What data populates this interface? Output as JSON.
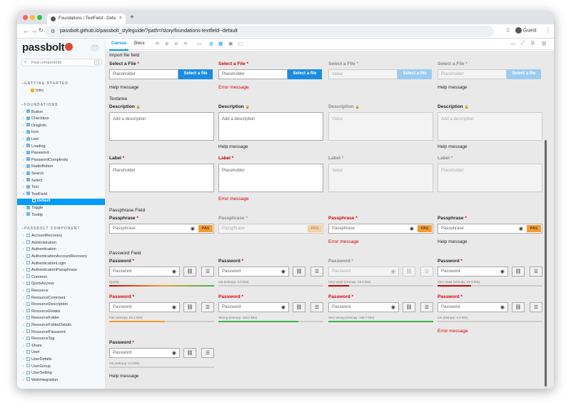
{
  "browser": {
    "tab_title": "Foundations / TextField - Defa",
    "url": "passbolt.github.io/passbolt_styleguide/?path=/story/foundations-textfield--default",
    "profile": "Guest"
  },
  "sidebar": {
    "logo": "passbolt",
    "more": "···",
    "search_placeholder": "Find components",
    "search_key": "/",
    "sections": [
      {
        "title": "GETTING STARTED",
        "items": [
          "Intro"
        ]
      },
      {
        "title": "FOUNDATIONS",
        "items": [
          "Button",
          "Checkbox",
          "DragInfo",
          "Icon",
          "Link",
          "Loading",
          "Password",
          "PasswordComplexity",
          "RadioButton",
          "Search",
          "Select",
          "Text",
          "TextField",
          "Default",
          "Toggle",
          "Tooltip"
        ]
      },
      {
        "title": "PASSBOLT COMPONENT",
        "items": [
          "AccountRecovery",
          "Administration",
          "Authentication",
          "AuthenticationAccountRecovery",
          "AuthenticationLogin",
          "AuthenticationPassphrase",
          "Common",
          "QuickAccess",
          "Resource",
          "ResourceComment",
          "ResourceDescription",
          "ResourceDetails",
          "ResourceFolder",
          "ResourceFolderDetails",
          "ResourcePassword",
          "ResourceTag",
          "Share",
          "User",
          "UserDetails",
          "UserGroup",
          "UserSetting",
          "WebIntegration"
        ]
      }
    ]
  },
  "toolbar": {
    "canvas": "Canvas",
    "docs": "Docs"
  },
  "content": {
    "import_heading": "Import file field",
    "file_label": "Select a File",
    "required_mark": "*",
    "file_btn": "Select a file",
    "file_inputs": [
      "Placeholder",
      "Placeholder",
      "Value",
      "Placeholder"
    ],
    "help": "Help message",
    "error": "Error message",
    "textarea_heading": "Textarea",
    "desc_label": "Description",
    "lock_icon": "🔒",
    "desc_inputs": [
      "Add a description",
      "Add a description",
      "Value",
      "Add a description"
    ],
    "label_label": "Label",
    "label_inputs": [
      "Placeholder",
      "Placeholder",
      "Value",
      "Placeholder"
    ],
    "pass_heading": "Passphrase Field",
    "pass_label": "Passphrase",
    "pass_inputs": [
      "Passphrase",
      "Passphrase",
      "Passphrase",
      "Passphrase"
    ],
    "pas": "PAS",
    "pw_heading": "Password Field",
    "pw_label": "Password",
    "pw_placeholder": "Password",
    "q": [
      "Quality",
      "n/a (entropy: 0.0 bits)",
      "Very weak (entropy: 29.9 bits)",
      "Very weak (entropy: 49.9 bits)",
      "Fair (entropy: 83.2 bits)",
      "Strong (entropy: 118.0 bits)",
      "Very strong (entropy: 156.7 bits)",
      "n/a (entropy: 0.0 bits)",
      "n/a (entropy: 0.0 bits)"
    ]
  }
}
